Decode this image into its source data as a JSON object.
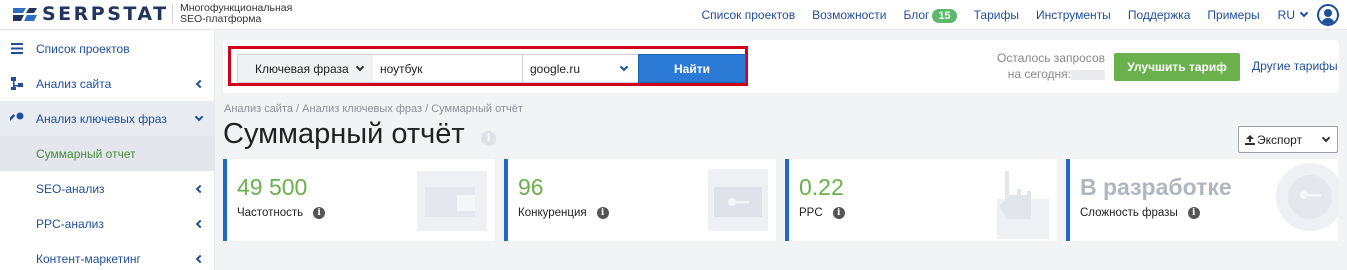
{
  "header": {
    "logo_text": "SERPSTAT",
    "tagline_line1": "Многофункциональная",
    "tagline_line2": "SEO-платформа",
    "nav": [
      "Список проектов",
      "Возможности",
      "Блог",
      "Тарифы",
      "Инструменты",
      "Поддержка",
      "Примеры"
    ],
    "blog_badge": "15",
    "lang": "RU"
  },
  "sidebar": {
    "items": [
      {
        "label": "Список проектов",
        "icon": "menu-icon"
      },
      {
        "label": "Анализ сайта",
        "icon": "sitemap-icon"
      },
      {
        "label": "Анализ ключевых фраз",
        "icon": "key-icon"
      },
      {
        "label": "Суммарный отчет"
      },
      {
        "label": "SEO-анализ"
      },
      {
        "label": "PPC-анализ"
      },
      {
        "label": "Контент-маркетинг"
      }
    ]
  },
  "search": {
    "type_label": "Ключевая фраза",
    "query": "ноутбук",
    "database": "google.ru",
    "button": "Найти"
  },
  "quota": {
    "line1": "Осталось запросов",
    "line2": "на сегодня:"
  },
  "plans": {
    "upgrade": "Улучшить тариф",
    "other": "Другие тарифы"
  },
  "breadcrumb": "Анализ сайта / Анализ ключевых фраз / Суммарный отчёт",
  "page_title": "Суммарный отчёт",
  "info_glyph": "i",
  "export_label": "Экспорт",
  "cards": [
    {
      "value": "49 500",
      "label": "Частотность"
    },
    {
      "value": "96",
      "label": "Конкуренция"
    },
    {
      "value": "0.22",
      "label": "PPC"
    },
    {
      "value": "В разработке",
      "label": "Сложность фразы"
    }
  ],
  "colors": {
    "brand": "#22355f",
    "link": "#1f4e9c",
    "accent_green": "#6ab04c",
    "primary_blue": "#2b7bd6",
    "highlight_red": "#d0021b"
  }
}
